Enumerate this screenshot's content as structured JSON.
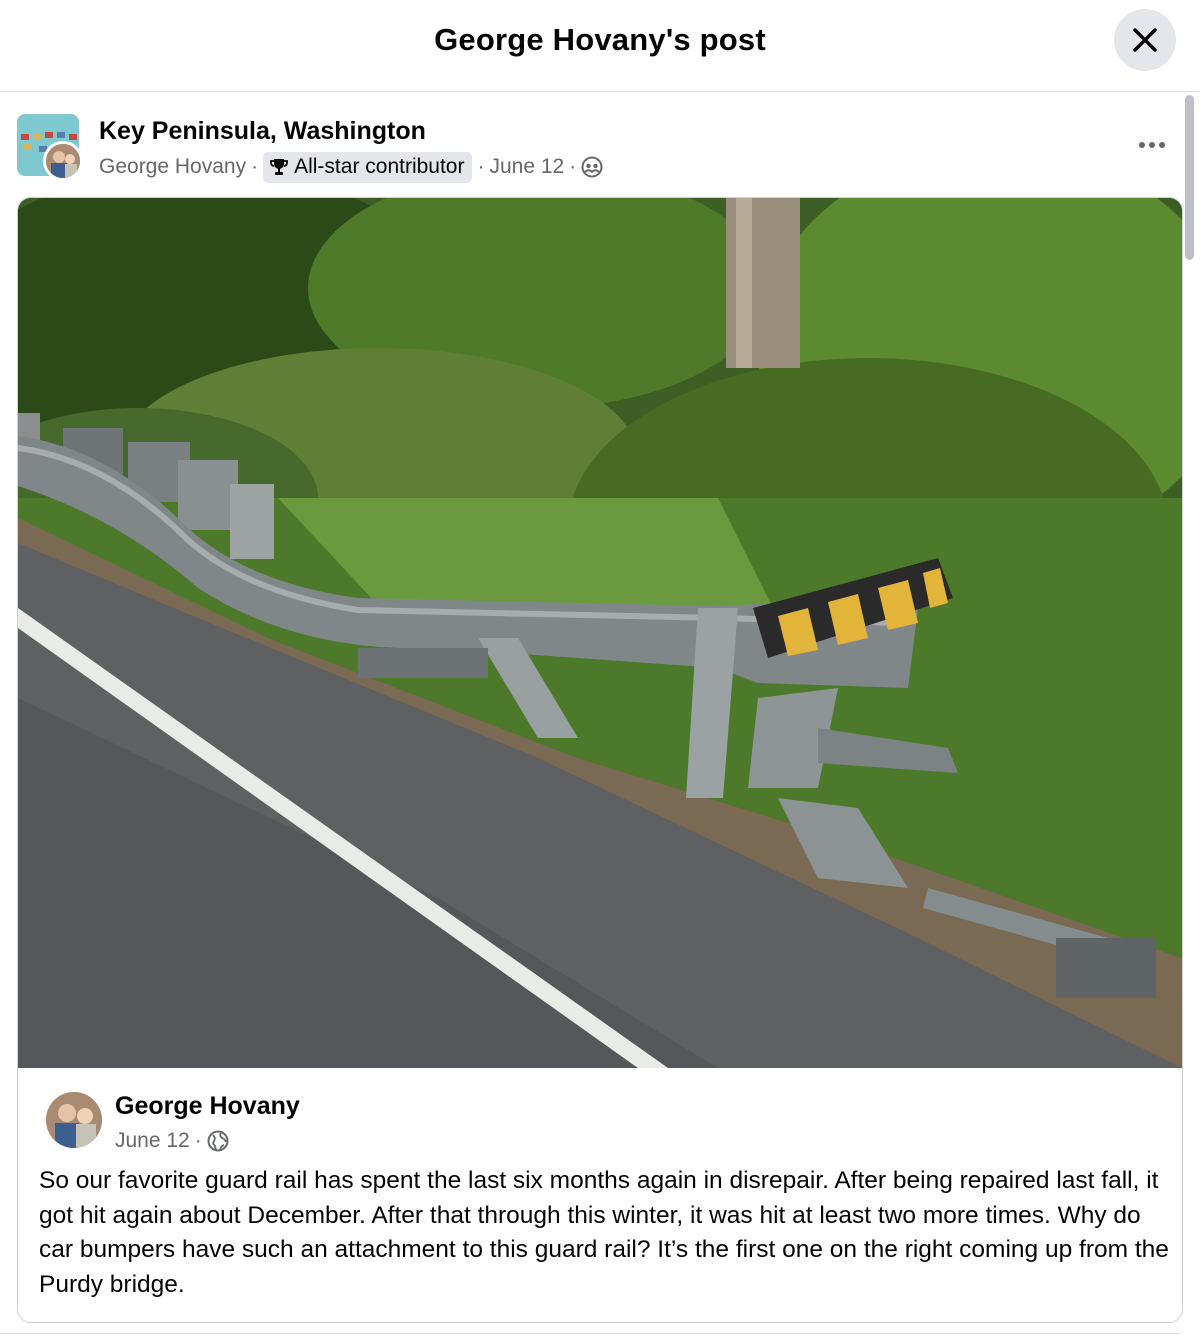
{
  "dialog": {
    "title": "George Hovany's post",
    "close_icon": "close-icon"
  },
  "post": {
    "group_name": "Key Peninsula, Washington",
    "author": "George Hovany",
    "separator": "·",
    "badge_icon": "trophy-icon",
    "badge_label": "All-star contributor",
    "date": "June 12",
    "audience_icon": "members-icon",
    "more_icon": "more-options-icon"
  },
  "shared_post": {
    "photo_icon": "photo-damaged-guard-rail",
    "author": "George Hovany",
    "date": "June 12",
    "separator": "·",
    "audience_icon": "globe-icon",
    "text": "So our favorite guard rail has spent the last six months again in disrepair. After being repaired last fall, it got hit again about December. After that through this winter, it was hit at least two more times. Why do car bumpers have such an attachment to this guard rail? It’s the first one on the right coming up from the Purdy bridge."
  },
  "colors": {
    "secondary_text": "#65676b",
    "primary_text": "#050505",
    "button_bg": "#e4e6eb",
    "divider": "#dadde1"
  }
}
